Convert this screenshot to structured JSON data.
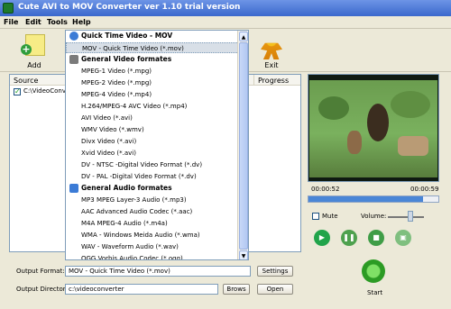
{
  "window": {
    "title": "Cute AVI to MOV Converter ver 1.10  trial version"
  },
  "menu": [
    "File",
    "Edit",
    "Tools",
    "Help"
  ],
  "toolbar": {
    "add_label": "Add",
    "exit_label": "Exit"
  },
  "filelist": {
    "headers": [
      "Source",
      "Progress"
    ],
    "rows": [
      {
        "source": "C:\\VideoConverte",
        "checked": true
      }
    ]
  },
  "output_dropdown": {
    "groups": [
      {
        "name": "Quick Time Video - MOV",
        "items": [
          "MOV - Quick Time Video (*.mov)"
        ]
      },
      {
        "name": "General Video formates",
        "items": [
          "MPEG-1 Video (*.mpg)",
          "MPEG-2 Video (*.mpg)",
          "MPEG-4 Video (*.mp4)",
          "H.264/MPEG-4 AVC Video (*.mp4)",
          "AVI Video (*.avi)",
          "WMV Video (*.wmv)",
          "Divx Video (*.avi)",
          "Xvid Video (*.avi)",
          "DV - NTSC -Digital Video Format (*.dv)",
          "DV - PAL -Digital Video Format (*.dv)"
        ]
      },
      {
        "name": "General Audio formates",
        "items": [
          "MP3 MPEG Layer-3 Audio (*.mp3)",
          "AAC Advanced Audio Codec (*.aac)",
          "M4A MPEG-4 Audio (*.m4a)",
          "WMA - Windows Meida Audio (*.wma)",
          "WAV - Waveform Audio (*.wav)",
          "OGG Vorbis Audio Codec (*.ogg)"
        ]
      }
    ],
    "selected": "MOV - Quick Time Video (*.mov)"
  },
  "player": {
    "time_current": "00:00:52",
    "time_total": "00:00:59",
    "progress": 0.88,
    "mute_label": "Mute",
    "mute_checked": false,
    "volume_label": "Volume:"
  },
  "output": {
    "format_label": "Output Format:",
    "format_value": "MOV - Quick Time Video (*.mov)",
    "settings_label": "Settings",
    "dir_label": "Output Directory:",
    "dir_value": "c:\\videoconverter",
    "browse_label": "Brows",
    "open_label": "Open",
    "start_label": "Start"
  }
}
